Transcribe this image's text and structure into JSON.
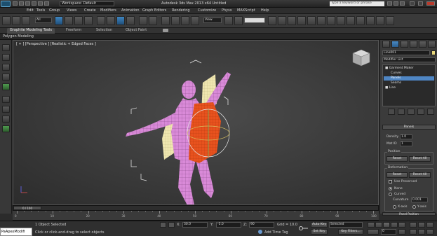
{
  "title_bar": {
    "workspace_label": "Workspace: Default",
    "window_title": "Autodesk 3ds Max 2013 x64     Untitled",
    "search_placeholder": "Type a keyword or phrase"
  },
  "menu": [
    "Edit",
    "Tools",
    "Group",
    "Views",
    "Create",
    "Modifiers",
    "Animation",
    "Graph Editors",
    "Rendering",
    "Customize",
    "Physx",
    "MAXScript",
    "Help"
  ],
  "toolbar": {
    "selection_filter": "All",
    "reference_coord": "View"
  },
  "ribbon": {
    "tabs": [
      "Graphite Modeling Tools",
      "Freeform",
      "Selection",
      "Object Paint"
    ],
    "active_tab": 0,
    "sub_label": "Polygon Modeling"
  },
  "viewport": {
    "label": "[ + ] [Perspective ] [Realistic + Edged Faces ]"
  },
  "command_panel": {
    "object_name": "Line001",
    "modifier_list_label": "Modifier List",
    "stack": [
      {
        "label": "Garment Maker",
        "level": 0
      },
      {
        "label": "Curves",
        "level": 1
      },
      {
        "label": "Panels",
        "level": 1
      },
      {
        "label": "Seams",
        "level": 1
      },
      {
        "label": "Line",
        "level": 0
      }
    ],
    "stack_selected": 2,
    "panels_rollout": "Panels",
    "density_label": "Density",
    "density_value": "1.0",
    "matid_label": "Mat ID",
    "matid_value": "1",
    "position_group": "Position",
    "reset_label": "Reset",
    "reset_all_label": "Reset All",
    "deformation_group": "Deformation",
    "use_preserved_label": "Use Preserved",
    "none_label": "None",
    "curved_label": "Curved",
    "curvature_label": "Curvature",
    "curvature_value": "0.001",
    "x_axis_label": "X-axis",
    "y_axis_label": "Y-axis",
    "panel_position_label": "Panel Position"
  },
  "timeline": {
    "slider_label": "0 / 100",
    "ticks": [
      "0",
      "10",
      "20",
      "30",
      "40",
      "50",
      "60",
      "70",
      "80",
      "90",
      "100"
    ]
  },
  "status_bar": {
    "maxscript_text": "PaApexModifi",
    "objects_selected": "1 Object Selected",
    "prompt": "Click or click-and-drag to select objects",
    "x_label": "X:",
    "x_value": "30.0",
    "y_label": "Y:",
    "y_value": "-5.0",
    "z_label": "Z:",
    "z_value": "90",
    "grid_label": "Grid = 10.0",
    "add_time_tag": "Add Time Tag",
    "auto_key": "Auto Key",
    "selected_dropdown": "Selected",
    "set_key": "Set Key",
    "key_filters": "Key Filters...",
    "frame_value": "0"
  },
  "colors": {
    "garment_orange": "#e8521e",
    "garment_cream": "#efe6b0",
    "figure_pink": "#d98ad8",
    "selection_blue": "#4f86c4"
  }
}
